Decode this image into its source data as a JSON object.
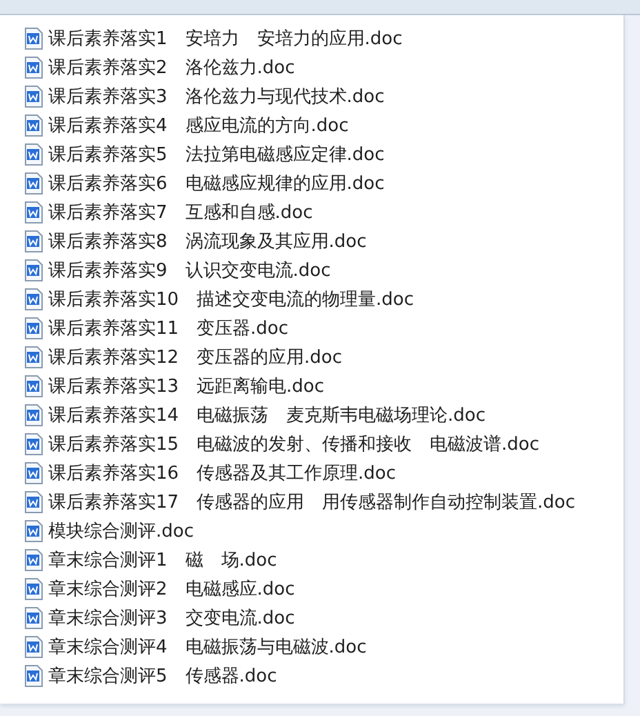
{
  "files": [
    {
      "name": "课后素养落实1　安培力　安培力的应用.doc"
    },
    {
      "name": "课后素养落实2　洛伦兹力.doc"
    },
    {
      "name": "课后素养落实3　洛伦兹力与现代技术.doc"
    },
    {
      "name": "课后素养落实4　感应电流的方向.doc"
    },
    {
      "name": "课后素养落实5　法拉第电磁感应定律.doc"
    },
    {
      "name": "课后素养落实6　电磁感应规律的应用.doc"
    },
    {
      "name": "课后素养落实7　互感和自感.doc"
    },
    {
      "name": "课后素养落实8　涡流现象及其应用.doc"
    },
    {
      "name": "课后素养落实9　认识交变电流.doc"
    },
    {
      "name": "课后素养落实10　描述交变电流的物理量.doc"
    },
    {
      "name": "课后素养落实11　变压器.doc"
    },
    {
      "name": "课后素养落实12　变压器的应用.doc"
    },
    {
      "name": "课后素养落实13　远距离输电.doc"
    },
    {
      "name": "课后素养落实14　电磁振荡　麦克斯韦电磁场理论.doc"
    },
    {
      "name": "课后素养落实15　电磁波的发射、传播和接收　电磁波谱.doc"
    },
    {
      "name": "课后素养落实16　传感器及其工作原理.doc"
    },
    {
      "name": "课后素养落实17　传感器的应用　用传感器制作自动控制装置.doc"
    },
    {
      "name": "模块综合测评.doc"
    },
    {
      "name": "章末综合测评1　磁　场.doc"
    },
    {
      "name": "章末综合测评2　电磁感应.doc"
    },
    {
      "name": "章末综合测评3　交变电流.doc"
    },
    {
      "name": "章末综合测评4　电磁振荡与电磁波.doc"
    },
    {
      "name": "章末综合测评5　传感器.doc"
    }
  ]
}
